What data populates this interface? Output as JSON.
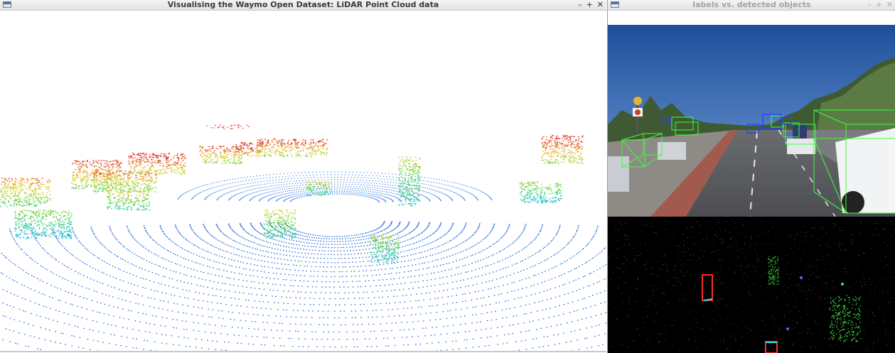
{
  "left_window": {
    "title": "Visualising the Waymo Open Dataset: LiDAR Point Cloud data",
    "icon": "app-window-icon",
    "controls": {
      "minimize": "–",
      "maximize": "+",
      "close": "✕"
    }
  },
  "right_window": {
    "title": "labels vs. detected objects",
    "icon": "app-window-icon",
    "controls": {
      "minimize": "–",
      "maximize": "+",
      "close": "✕"
    }
  },
  "colors": {
    "point_low": "#1e6fe0",
    "point_mid": "#27c7cf",
    "point_high": "#e2352a",
    "label_box": "#3cff3c",
    "detection_box": "#2a3fff",
    "bev_label_box": "#ff2b2b",
    "bev_detection_box": "#27e0e8"
  }
}
